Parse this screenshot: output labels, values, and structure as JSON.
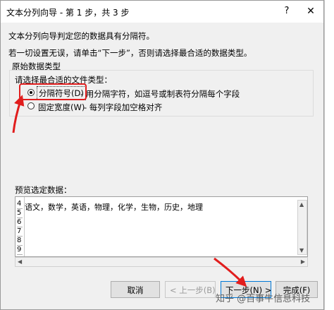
{
  "dialog": {
    "title": "文本分列向导 - 第 1 步，共 3 步",
    "help_glyph": "?",
    "close_glyph": "✕"
  },
  "intro": {
    "line1": "文本分列向导判定您的数据具有分隔符。",
    "line2": "若一切设置无误，请单击“下一步”，否则请选择最合适的数据类型。"
  },
  "original_type": {
    "group_label": "原始数据类型",
    "prompt": "请选择最合适的文件类型：",
    "options": [
      {
        "label": "分隔符号(D)",
        "description": "- 用分隔字符，如逗号或制表符分隔每个字段",
        "selected": true
      },
      {
        "label": "固定宽度(W)",
        "description": "- 每列字段加空格对齐",
        "selected": false
      }
    ]
  },
  "preview": {
    "label": "预览选定数据：",
    "row_numbers": [
      "4",
      "5",
      "6",
      "7",
      "8",
      "9"
    ],
    "first_line": "语文，数学，英语，物理，化学，生物，历史，地理"
  },
  "buttons": {
    "cancel": "取消",
    "prev": "< 上一步(B)",
    "next": "下一步(N) >",
    "finish": "完成(F)"
  },
  "watermark": "知乎 @百事牛信息科技",
  "annotation_color": "#e11d1d"
}
